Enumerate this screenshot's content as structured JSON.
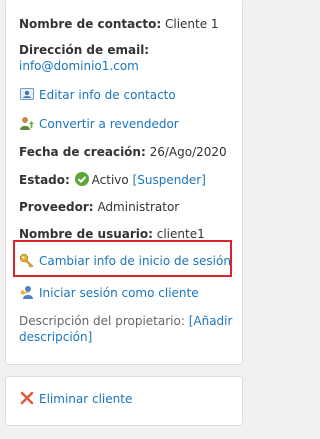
{
  "contact": {
    "contact_name_label": "Nombre de contacto:",
    "contact_name_value": "Cliente 1",
    "email_label": "Dirección de email:",
    "email_value": "info@dominio1.com"
  },
  "actions": {
    "edit_contact": "Editar info de contacto",
    "convert_reseller": "Convertir a revendedor"
  },
  "details": {
    "creation_date_label": "Fecha de creación:",
    "creation_date_value": "26/Ago/2020",
    "status_label": "Estado:",
    "status_value": "Activo",
    "suspend_link": "[Suspender]",
    "provider_label": "Proveedor:",
    "provider_value": "Administrator",
    "username_label": "Nombre de usuario:",
    "username_value": "cliente1"
  },
  "login_actions": {
    "change_login": "Cambiar info de inicio de sesión",
    "login_as_client": "Iniciar sesión como cliente"
  },
  "owner": {
    "description_label": "Descripción del propietario:",
    "add_description_part1": "[Añadir",
    "add_description_part2": "descripción]"
  },
  "danger": {
    "delete_client": "Eliminar cliente"
  },
  "colors": {
    "link": "#1b75bb",
    "highlight_border": "#d9232d",
    "status_ok": "#5aa83a",
    "delete_icon": "#e05a3a"
  }
}
